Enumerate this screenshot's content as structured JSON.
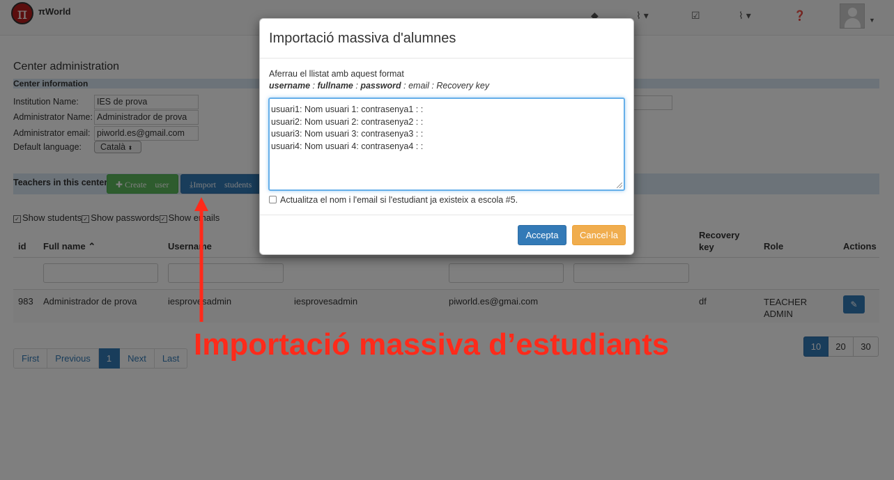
{
  "navbar": {
    "logo_glyph": "π",
    "brand": "πWorld",
    "icons": [
      "home-icon",
      "paperclip-icon",
      "edit-check-icon",
      "paperclip-icon",
      "help-icon"
    ]
  },
  "center": {
    "heading": "Center administration",
    "info_title": "Center information",
    "fields": [
      {
        "label": "Institution Name:",
        "value": "IES de prova"
      },
      {
        "label": "Administrator Name:",
        "value": "Administrador de prova"
      },
      {
        "label": "Administrator email:",
        "value": "piworld.es@gmail.com"
      }
    ],
    "language_label": "Default language:",
    "language_value": "Català"
  },
  "teachers": {
    "title": "Teachers in this center",
    "create_label": "Create    user",
    "import_label": "Import    students"
  },
  "toggles": [
    "Show students",
    "Show passwords",
    "Show emails"
  ],
  "table": {
    "headers": {
      "id": "id",
      "fullname": "Full name",
      "username": "Username",
      "recovery_line1": "Recovery",
      "recovery_line2": "key",
      "role": "Role",
      "actions": "Actions"
    },
    "row": {
      "id": "983",
      "fullname": "Administrador de prova",
      "username": "iesprovesadmin",
      "password": "iesprovesadmin",
      "email": "piworld.es@gmai.com",
      "recovery": "df",
      "role_line1": "TEACHER",
      "role_line2": "ADMIN"
    }
  },
  "pagination": {
    "pages": [
      "First",
      "Previous",
      "1",
      "Next",
      "Last"
    ],
    "active": "1",
    "sizes": [
      "10",
      "20",
      "30"
    ],
    "active_size": "10"
  },
  "modal": {
    "title": "Importació massiva d'alumnes",
    "intro": "Aferrau el llistat amb aquest format",
    "format": {
      "username": "username",
      "fullname": "fullname",
      "password": "password",
      "rest": " : email : Recovery key"
    },
    "lines": [
      "usuari1: Nom usuari 1: contrasenya1 : :",
      "usuari2: Nom usuari 2: contrasenya2 : :",
      "usuari3: Nom usuari 3: contrasenya3 : :",
      "usuari4: Nom usuari 4: contrasenya4 : :"
    ],
    "update_label": "Actualitza el nom i l'email si l'estudiant ja existeix a escola #5.",
    "ok_label": "Accepta",
    "cancel_label": "Cancel·la"
  },
  "annotation": {
    "text": "Importació massiva d’estudiants",
    "color": "#ff2a1a"
  }
}
